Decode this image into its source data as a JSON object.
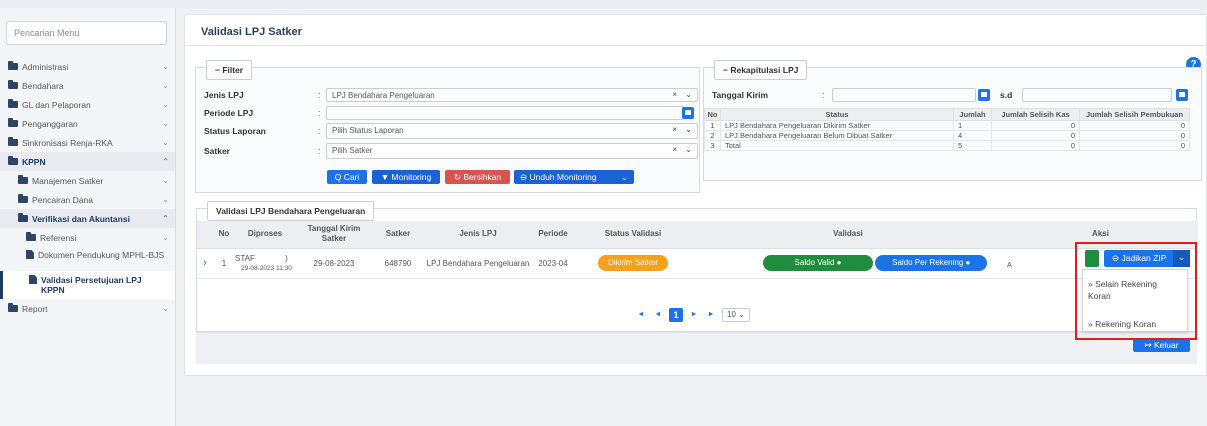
{
  "search_placeholder": "Pencarian Menu",
  "sidebar": {
    "items": [
      {
        "label": "Administrasi"
      },
      {
        "label": "Bendahara"
      },
      {
        "label": "GL dan Pelaporan"
      },
      {
        "label": "Penganggaran"
      },
      {
        "label": "Sinkronisasi Renja-RKA"
      },
      {
        "label": "KPPN"
      },
      {
        "label": "Manajemen Satker"
      },
      {
        "label": "Pencairan Dana"
      },
      {
        "label": "Verifikasi dan Akuntansi"
      },
      {
        "label": "Referensi"
      },
      {
        "label": "Dokumen Pendukung MPHL-BJS"
      },
      {
        "label": "Validasi Persetujuan LPJ KPPN"
      },
      {
        "label": "Report"
      }
    ]
  },
  "page": {
    "title": "Validasi LPJ Satker",
    "help": "?"
  },
  "filter": {
    "legend": "− Filter",
    "jenis_label": "Jenis LPJ",
    "jenis_value": "LPJ Bendahara Pengeluaran",
    "periode_label": "Periode LPJ",
    "periode_value": "",
    "status_label": "Status Laporan",
    "status_placeholder": "Pilih Status Laporan",
    "satker_label": "Satker",
    "satker_placeholder": "Pilih Satker",
    "colon": ":",
    "clear": "×",
    "caret": "⌄",
    "btn_cari": "Q  Cari",
    "btn_monitoring": "▼  Monitoring",
    "btn_bersihkan": "↻  Bersihkan",
    "btn_unduh": "⊖  Unduh Monitoring",
    "btn_unduh_caret": "⌄"
  },
  "rekap": {
    "legend": "− Rekapitulasi LPJ",
    "tanggal_label": "Tanggal Kirim",
    "colon": ":",
    "sd": "s.d",
    "headers": [
      "No",
      "Status",
      "Jumlah",
      "Jumlah Selisih Kas",
      "Jumlah Selisih Pembukuan"
    ],
    "rows": [
      [
        "1",
        "LPJ Bendahara Pengeluaran Dikirim Satker",
        "1",
        "0",
        "0"
      ],
      [
        "2",
        "LPJ Bendahara Pengeluaran Belum Dibuat Satker",
        "4",
        "0",
        "0"
      ],
      [
        "3",
        "Total",
        "5",
        "0",
        "0"
      ]
    ]
  },
  "validasi": {
    "legend": "Validasi LPJ Bendahara Pengeluaran",
    "headers": [
      "No",
      "Diproses",
      "Tanggal Kirim Satker",
      "Satker",
      "Jenis LPJ",
      "Periode",
      "Status Validasi",
      "Validasi",
      "Aksi"
    ],
    "row": {
      "no": "1",
      "diproses_user": "STAF",
      "diproses_extra": ")",
      "diproses_time": "29-08-2023 11:30",
      "tanggal": "29-08-2023",
      "satker": "648790",
      "jenis": "LPJ Bendahara Pengeluaran",
      "periode": "2023-04",
      "status": "Dikirim Satker",
      "saldo_valid": "Saldo Valid  ●",
      "saldo_rekening": "Saldo Per Rekening  ●",
      "aksi_a": "A"
    },
    "expand": "›",
    "jadikan_zip": "⊖  Jadikan ZIP",
    "jadikan_caret": "⌄",
    "dropdown": [
      "» Selain Rekening Koran",
      "» Rekening Koran"
    ],
    "pager": {
      "first": "◄",
      "prev": "◄",
      "current": "1",
      "next": "►",
      "last": "►",
      "size": "10  ⌄"
    },
    "keluar": "↦  Keluar"
  },
  "colors": {
    "accent": "#1a73e8",
    "status_orange": "#f7a01b",
    "valid_green": "#1e8e3e",
    "highlight_red": "#e21c1c",
    "nav_dark": "#2f4566"
  }
}
